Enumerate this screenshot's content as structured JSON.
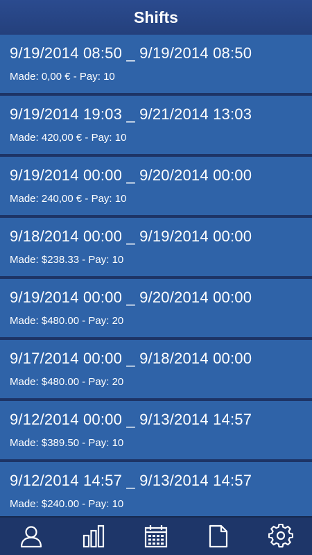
{
  "header": {
    "title": "Shifts"
  },
  "shifts": [
    {
      "range": "9/19/2014 08:50 _ 9/19/2014 08:50",
      "meta": "Made: 0,00 € - Pay: 10"
    },
    {
      "range": "9/19/2014 19:03 _ 9/21/2014 13:03",
      "meta": "Made: 420,00 € - Pay: 10"
    },
    {
      "range": "9/19/2014 00:00 _ 9/20/2014 00:00",
      "meta": "Made: 240,00 € - Pay: 10"
    },
    {
      "range": "9/18/2014 00:00 _ 9/19/2014 00:00",
      "meta": "Made: $238.33 - Pay: 10"
    },
    {
      "range": "9/19/2014 00:00 _ 9/20/2014 00:00",
      "meta": "Made: $480.00 - Pay: 20"
    },
    {
      "range": "9/17/2014 00:00 _ 9/18/2014 00:00",
      "meta": "Made: $480.00 - Pay: 20"
    },
    {
      "range": "9/12/2014 00:00 _ 9/13/2014 14:57",
      "meta": "Made: $389.50 - Pay: 10"
    },
    {
      "range": "9/12/2014 14:57 _ 9/13/2014 14:57",
      "meta": "Made: $240.00 - Pay: 10"
    }
  ],
  "tabs": [
    {
      "icon": "person-icon"
    },
    {
      "icon": "bar-chart-icon"
    },
    {
      "icon": "calendar-icon"
    },
    {
      "icon": "document-icon"
    },
    {
      "icon": "gear-icon"
    }
  ],
  "colors": {
    "header": "#24407c",
    "item": "#2f63a8",
    "separator": "#1d3466",
    "tabbar": "#1e3669",
    "text": "#ffffff"
  }
}
